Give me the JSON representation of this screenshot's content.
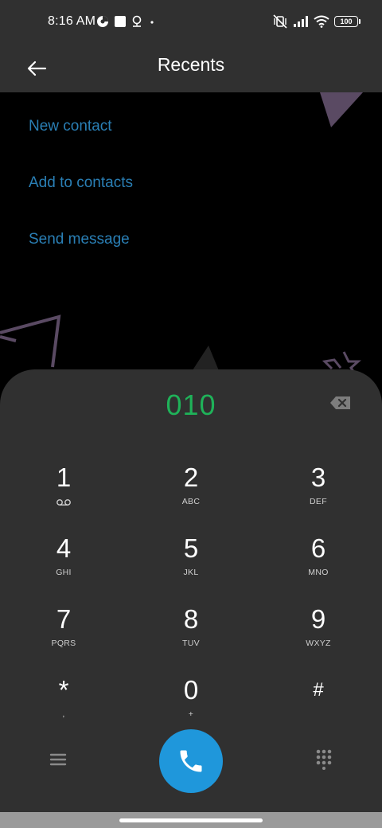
{
  "status_bar": {
    "time": "8:16 AM",
    "battery_level": "100",
    "left_icons": [
      "data-saver-icon",
      "notification-square-icon",
      "location-pin-icon",
      "dot-icon"
    ],
    "right_icons": [
      "vibrate-off-icon",
      "signal-icon",
      "wifi-icon",
      "battery-icon"
    ]
  },
  "app_bar": {
    "title": "Recents",
    "back_icon": "arrow-left-icon"
  },
  "actions": {
    "new_contact": "New contact",
    "add_to_contacts": "Add to contacts",
    "send_message": "Send message"
  },
  "dialer": {
    "number": "010",
    "backspace_icon": "backspace-icon",
    "keys": [
      {
        "digit": "1",
        "letters": "",
        "icon": "voicemail-icon"
      },
      {
        "digit": "2",
        "letters": "ABC"
      },
      {
        "digit": "3",
        "letters": "DEF"
      },
      {
        "digit": "4",
        "letters": "GHI"
      },
      {
        "digit": "5",
        "letters": "JKL"
      },
      {
        "digit": "6",
        "letters": "MNO"
      },
      {
        "digit": "7",
        "letters": "PQRS"
      },
      {
        "digit": "8",
        "letters": "TUV"
      },
      {
        "digit": "9",
        "letters": "WXYZ"
      },
      {
        "digit": "*",
        "letters": ","
      },
      {
        "digit": "0",
        "letters": "+"
      },
      {
        "digit": "#",
        "letters": ""
      }
    ],
    "menu_icon": "menu-icon",
    "call_icon": "phone-icon",
    "keypad_icon": "dialpad-icon"
  },
  "colors": {
    "bar_bg": "#303030",
    "link": "#2a7fb5",
    "number": "#1fb259",
    "call_button": "#1f97db",
    "wallpaper_bg": "#000000",
    "wallpaper_shapes": "#5a4a63"
  }
}
